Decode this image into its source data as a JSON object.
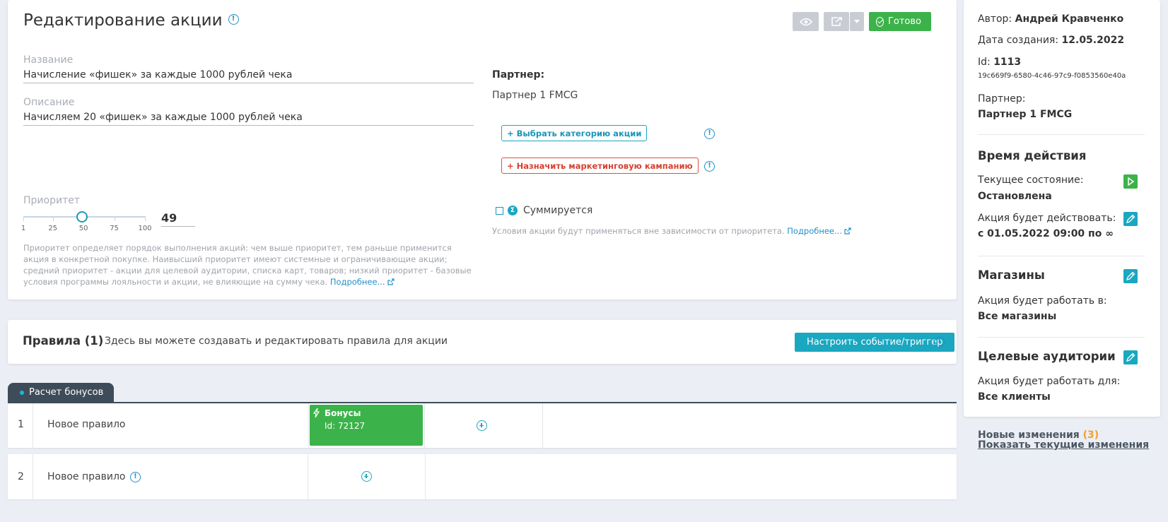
{
  "header": {
    "title": "Редактирование акции",
    "done_label": "Готово"
  },
  "form": {
    "name_label": "Название",
    "name_value": "Начисление «фишек» за каждые 1000 рублей чека",
    "desc_label": "Описание",
    "desc_value": "Начисляем 20 «фишек» за каждые 1000 рублей чека",
    "priority_label": "Приоритет",
    "priority_value": 49,
    "priority_display": "49",
    "priority_ticks": [
      "1",
      "25",
      "50",
      "75",
      "100"
    ],
    "priority_hint": "Приоритет определяет порядок выполнения акций: чем выше приоритет, тем раньше применится акция в конкретной покупке. Наивысший приоритет имеют системные и ограничивающие акции; средний приоритет - акции для целевой аудитории, списка карт, товаров; низкий приоритет - базовые условия программы лояльности и акции, не влияющие на сумму чека.",
    "more_link": "Подробнее...",
    "partner_label": "Партнер:",
    "partner_value": "Партнер 1 FMCG",
    "category_button": "+ Выбрать категорию акции",
    "campaign_button": "+ Назначить маркетинговую кампанию",
    "summable_label": "Суммируется",
    "summable_checked": false,
    "summable_hint": "Условия акции будут применяться вне зависимости от приоритета."
  },
  "rules": {
    "title": "Правила (1)",
    "description": "Здесь вы можете создавать и редактировать правила для акции",
    "trigger_button": "Настроить событие/триггер",
    "tab_label": "Расчет бонусов",
    "rows": [
      {
        "num": "1",
        "name": "Новое правило",
        "bonus_title": "Бонусы",
        "bonus_id": "Id: 72127"
      },
      {
        "num": "2",
        "name": "Новое правило"
      }
    ]
  },
  "sidebar": {
    "author_label": "Автор:",
    "author_value": "Андрей Кравченко",
    "created_label": "Дата создания:",
    "created_value": "12.05.2022",
    "id_label": "Id:",
    "id_value": "1113",
    "guid": "19c669f9-6580-4c46-97c9-f0853560e40a",
    "partner_label": "Партнер:",
    "partner_value": "Партнер 1 FMCG",
    "time_heading": "Время действия",
    "state_label": "Текущее состояние:",
    "state_value": "Остановлена",
    "active_label": "Акция будет действовать:",
    "active_value": "с 01.05.2022 09:00 по ∞",
    "stores_heading": "Магазины",
    "stores_label": "Акция будет работать в:",
    "stores_value": "Все магазины",
    "audience_heading": "Целевые аудитории",
    "audience_label": "Акция будет работать для:",
    "audience_value": "Все клиенты"
  },
  "changes": {
    "label": "Новые изменения",
    "count": "(3)",
    "show_link": "Показать текущие изменения"
  },
  "colors": {
    "accent": "#1aa7c0",
    "success": "#3bb34a",
    "danger": "#e74c3c",
    "link": "#1f8fc9",
    "tab_dark": "#3e4c5a"
  },
  "icons": [
    "info-icon",
    "eye-icon",
    "share-icon",
    "chevron-down-icon",
    "check-circle-icon",
    "external-link-icon",
    "sigma-icon",
    "lightning-icon",
    "plus-circle-icon",
    "play-icon",
    "pencil-icon"
  ]
}
